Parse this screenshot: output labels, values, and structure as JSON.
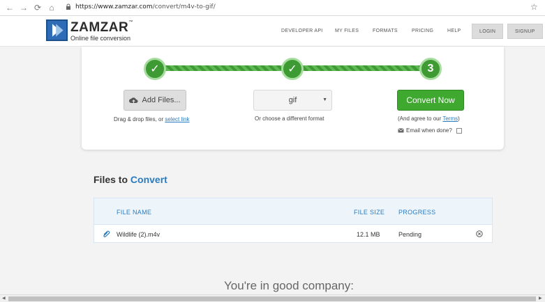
{
  "browser": {
    "url_scheme_host": "https://www.zamzar.com",
    "url_path": "/convert/m4v-to-gif/"
  },
  "header": {
    "brand": "ZAMZAR",
    "trademark": "™",
    "tagline": "Online file conversion",
    "nav": [
      "DEVELOPER API",
      "MY FILES",
      "FORMATS",
      "PRICING",
      "HELP"
    ],
    "login_label": "LOGIN",
    "signup_label": "SIGNUP"
  },
  "converter": {
    "step3_label": "3",
    "add_files_label": "Add Files...",
    "drag_hint": "Drag & drop files, or ",
    "select_link": "select link",
    "format_value": "gif",
    "format_hint": "Or choose a different format",
    "convert_label": "Convert Now",
    "agree_prefix": "(And agree to our ",
    "terms_link": "Terms",
    "agree_suffix": ")",
    "email_label": "Email when done?"
  },
  "files": {
    "title_prefix": "Files to ",
    "title_accent": "Convert",
    "columns": {
      "name": "FILE NAME",
      "size": "FILE SIZE",
      "progress": "PROGRESS"
    },
    "rows": [
      {
        "name": "Wildlife (2).m4v",
        "size": "12.1 MB",
        "progress": "Pending"
      }
    ]
  },
  "footer": {
    "good_company": "You're in good company:"
  },
  "colors": {
    "accent_blue": "#2a7bbf",
    "success_green": "#3ea82f"
  }
}
